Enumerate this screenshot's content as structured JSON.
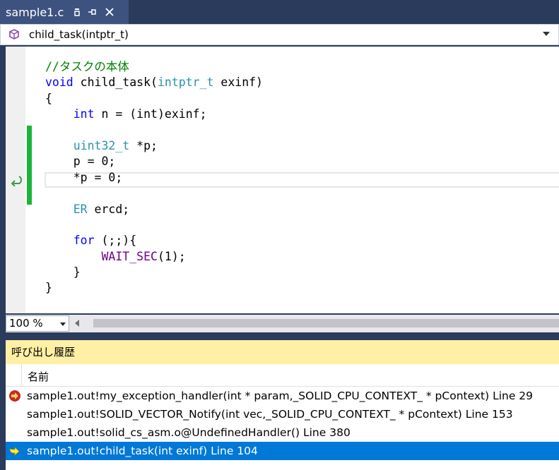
{
  "tab": {
    "title": "sample1.c"
  },
  "nav": {
    "scope": "child_task(intptr_t)"
  },
  "code_lines": [
    [
      {
        "t": "//タスクの本体",
        "c": "cm"
      }
    ],
    [
      {
        "t": "void",
        "c": "kw"
      },
      {
        "t": " child_task(",
        "c": ""
      },
      {
        "t": "intptr_t",
        "c": "ty"
      },
      {
        "t": " exinf)",
        "c": ""
      }
    ],
    [
      {
        "t": "{",
        "c": ""
      }
    ],
    [
      {
        "t": "    ",
        "c": ""
      },
      {
        "t": "int",
        "c": "kw"
      },
      {
        "t": " n = (int)exinf;",
        "c": ""
      }
    ],
    [],
    [
      {
        "t": "    ",
        "c": ""
      },
      {
        "t": "uint32_t",
        "c": "ty"
      },
      {
        "t": " *p;",
        "c": ""
      }
    ],
    [
      {
        "t": "    p = 0;",
        "c": ""
      }
    ],
    [
      {
        "t": "    *p = 0;",
        "c": ""
      }
    ],
    [],
    [
      {
        "t": "    ",
        "c": ""
      },
      {
        "t": "ER",
        "c": "ty"
      },
      {
        "t": " ercd;",
        "c": ""
      }
    ],
    [],
    [
      {
        "t": "    ",
        "c": ""
      },
      {
        "t": "for",
        "c": "kw"
      },
      {
        "t": " (;;){",
        "c": ""
      }
    ],
    [
      {
        "t": "        ",
        "c": ""
      },
      {
        "t": "WAIT_SEC",
        "c": "mc"
      },
      {
        "t": "(1);",
        "c": ""
      }
    ],
    [
      {
        "t": "    }",
        "c": ""
      }
    ],
    [
      {
        "t": "}",
        "c": ""
      }
    ]
  ],
  "zoom": {
    "value": "100 %"
  },
  "call_stack": {
    "title": "呼び出し履歴",
    "column_name": "名前",
    "rows": [
      {
        "text": "sample1.out!my_exception_handler(int * param,_SOLID_CPU_CONTEXT_ * pContext) Line 29",
        "icon": "exception-icon",
        "selected": false
      },
      {
        "text": "sample1.out!SOLID_VECTOR_Notify(int  vec,_SOLID_CPU_CONTEXT_ * pContext) Line 153",
        "icon": "",
        "selected": false
      },
      {
        "text": "sample1.out!solid_cs_asm.o@UndefinedHandler() Line 380",
        "icon": "",
        "selected": false
      },
      {
        "text": "sample1.out!child_task(int  exinf) Line 104",
        "icon": "current-frame-arrow-icon",
        "selected": true
      }
    ]
  },
  "colors": {
    "keyword": "#0000ff",
    "type": "#2b91af",
    "comment": "#008000",
    "macro": "#6f008a",
    "selection": "#0078d7",
    "panel_header": "#fff0a5",
    "change_bar": "#1bb33a"
  }
}
